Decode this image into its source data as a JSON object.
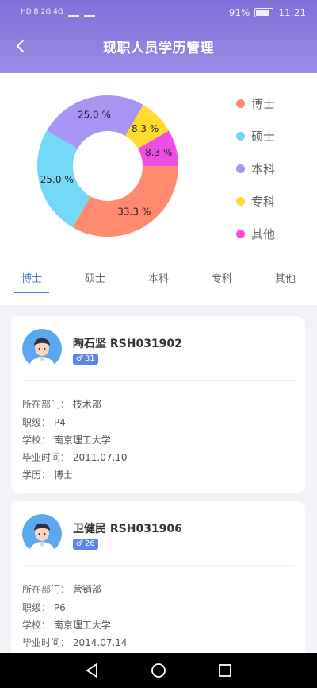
{
  "status": {
    "left_text": "HD B 2G 4G",
    "battery": "91%",
    "time": "11:21"
  },
  "header": {
    "title": "现职人员学历管理"
  },
  "chart_data": {
    "type": "pie",
    "labels": [
      "博士",
      "硕士",
      "本科",
      "专科",
      "其他"
    ],
    "values": [
      33.3,
      25.0,
      25.0,
      8.3,
      8.3
    ],
    "value_labels": [
      "33.3 %",
      "25.0 %",
      "25.0 %",
      "8.3 %",
      "8.3 %"
    ],
    "colors": [
      "#ff8a70",
      "#74d8f7",
      "#a894f2",
      "#ffdb2e",
      "#f04de2"
    ],
    "legend_position": "right"
  },
  "tabs": [
    {
      "label": "博士",
      "active": true
    },
    {
      "label": "硕士",
      "active": false
    },
    {
      "label": "本科",
      "active": false
    },
    {
      "label": "专科",
      "active": false
    },
    {
      "label": "其他",
      "active": false
    }
  ],
  "cards": [
    {
      "name": "陶石坚 RSH031902",
      "age": "31",
      "dept_label": "所在部门：",
      "dept": "技术部",
      "rank_label": "职级：",
      "rank": "P4",
      "school_label": "学校：",
      "school": "南京理工大学",
      "grad_label": "毕业时间：",
      "grad": "2011.07.10",
      "edu_label": "学历：",
      "edu": "博士"
    },
    {
      "name": "卫健民 RSH031906",
      "age": "26",
      "dept_label": "所在部门：",
      "dept": "营销部",
      "rank_label": "职级：",
      "rank": "P6",
      "school_label": "学校：",
      "school": "南京理工大学",
      "grad_label": "毕业时间：",
      "grad": "2014.07.14"
    }
  ]
}
